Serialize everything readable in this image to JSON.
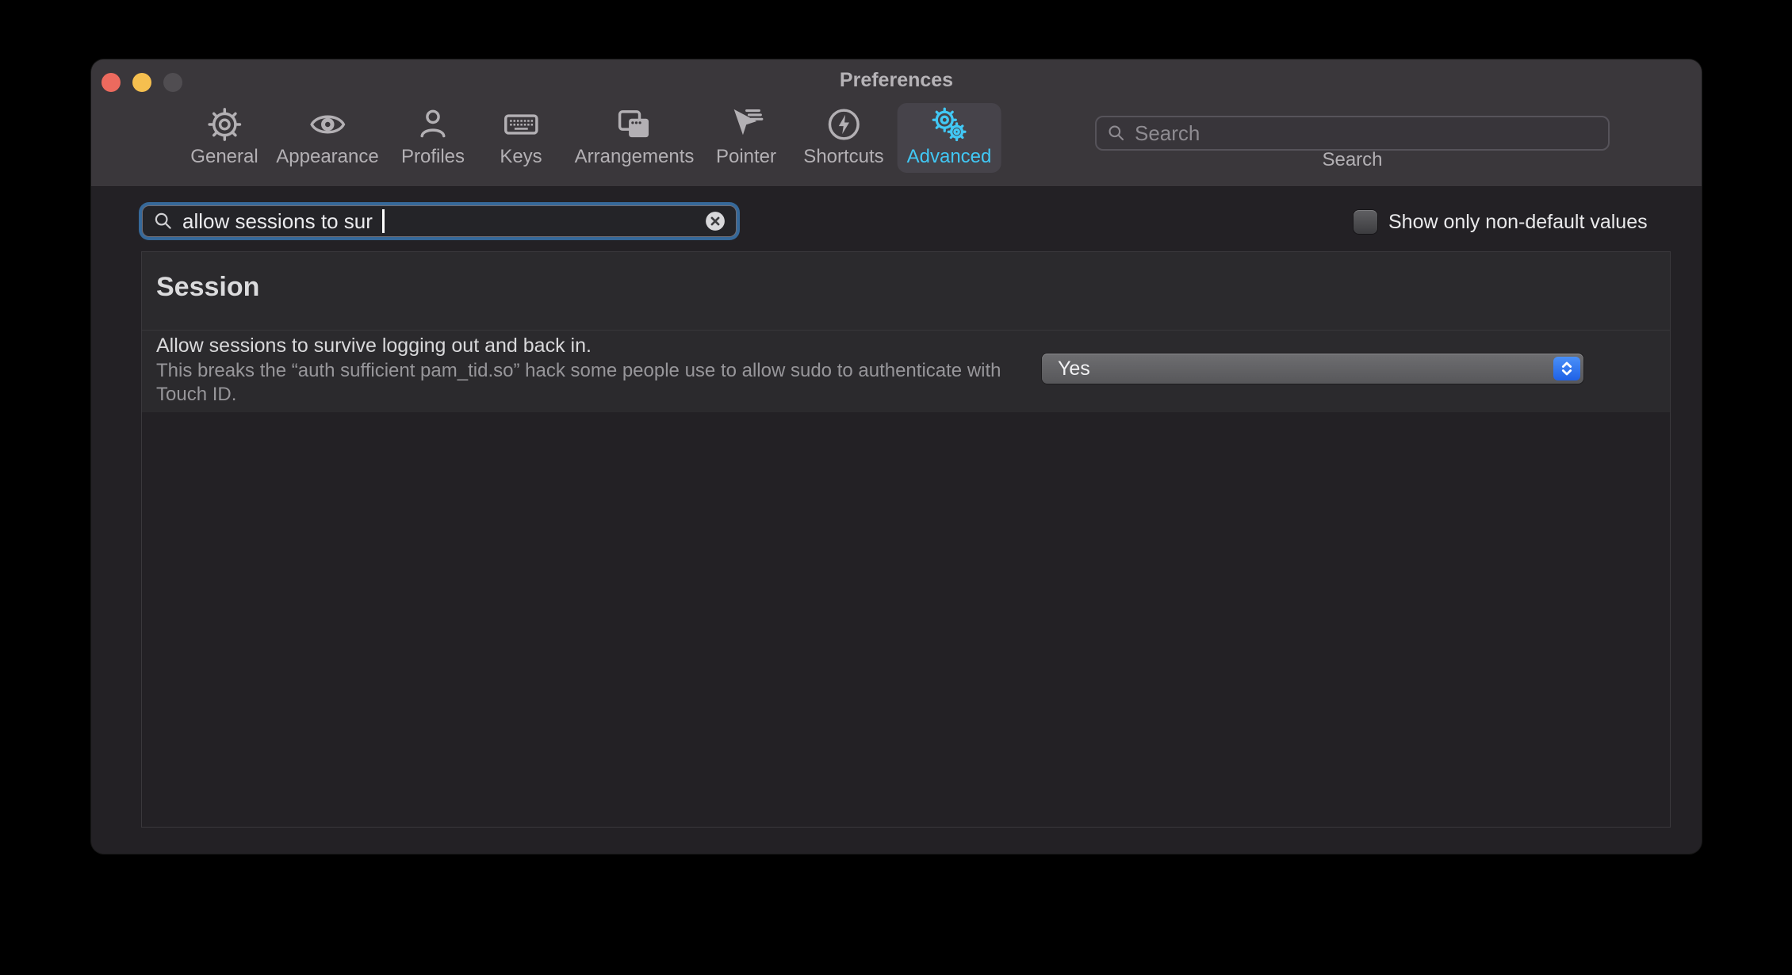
{
  "window": {
    "title": "Preferences"
  },
  "toolbar": {
    "tabs": [
      {
        "label": "General"
      },
      {
        "label": "Appearance"
      },
      {
        "label": "Profiles"
      },
      {
        "label": "Keys"
      },
      {
        "label": "Arrangements"
      },
      {
        "label": "Pointer"
      },
      {
        "label": "Shortcuts"
      },
      {
        "label": "Advanced"
      }
    ],
    "selected_tab": "Advanced",
    "search": {
      "placeholder": "Search",
      "caption": "Search"
    }
  },
  "filter_search": {
    "value": "allow sessions to sur"
  },
  "filters": {
    "show_only_non_default_label": "Show only non-default values",
    "show_only_non_default_checked": false
  },
  "content": {
    "section_heading": "Session",
    "setting": {
      "title": "Allow sessions to survive logging out and back in.",
      "description_lines": [
        "This breaks the “auth sufficient pam_tid.so” hack some people use to allow sudo to authenticate with",
        "Touch ID."
      ],
      "value": "Yes"
    }
  },
  "colors": {
    "accent_cyan": "#41c8f5",
    "focus_ring": "#36699a",
    "control_blue": "#2e72f0",
    "traffic_red": "#ec6a5e",
    "traffic_yellow": "#f5bf4f"
  }
}
